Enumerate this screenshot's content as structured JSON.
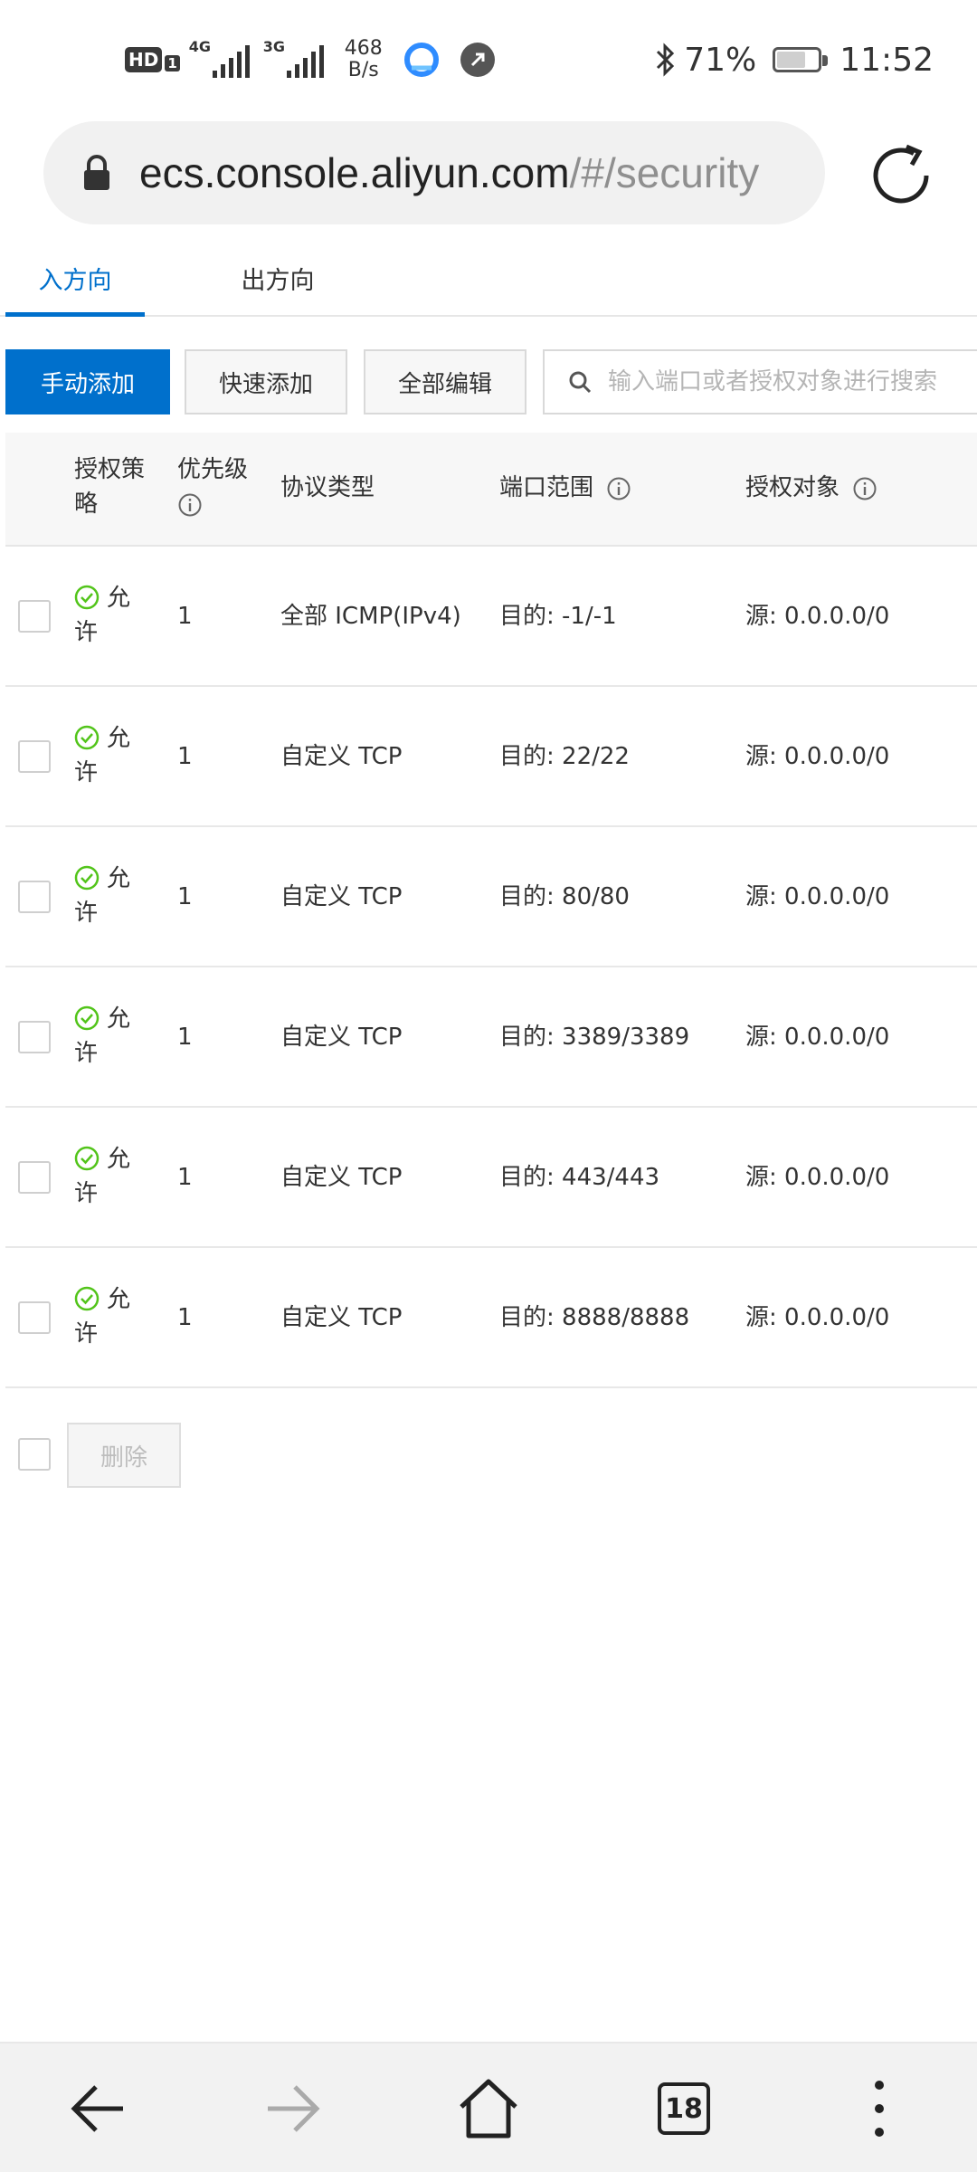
{
  "status_bar": {
    "hd": "HD",
    "sim_index": "1",
    "net1": "4G",
    "net2": "3G",
    "speed_value": "468",
    "speed_unit": "B/s",
    "battery_percent": "71%",
    "battery_level": 0.71,
    "time": "11:52"
  },
  "browser": {
    "url_host": "ecs.console.aliyun.com",
    "url_path": "/#/security",
    "tab_count": "18"
  },
  "tabs": [
    {
      "label": "入方向",
      "active": true
    },
    {
      "label": "出方向",
      "active": false
    }
  ],
  "toolbar": {
    "manual_add": "手动添加",
    "quick_add": "快速添加",
    "edit_all": "全部编辑",
    "search_placeholder": "输入端口或者授权对象进行搜索"
  },
  "table": {
    "headers": {
      "policy": "授权策略",
      "priority": "优先级",
      "protocol": "协议类型",
      "port_range": "端口范围",
      "auth_object": "授权对象"
    },
    "rows": [
      {
        "policy": "允许",
        "priority": "1",
        "protocol": "全部 ICMP(IPv4)",
        "port": "目的: -1/-1",
        "source": "源: 0.0.0.0/0"
      },
      {
        "policy": "允许",
        "priority": "1",
        "protocol": "自定义 TCP",
        "port": "目的: 22/22",
        "source": "源: 0.0.0.0/0"
      },
      {
        "policy": "允许",
        "priority": "1",
        "protocol": "自定义 TCP",
        "port": "目的: 80/80",
        "source": "源: 0.0.0.0/0"
      },
      {
        "policy": "允许",
        "priority": "1",
        "protocol": "自定义 TCP",
        "port": "目的: 3389/3389",
        "source": "源: 0.0.0.0/0"
      },
      {
        "policy": "允许",
        "priority": "1",
        "protocol": "自定义 TCP",
        "port": "目的: 443/443",
        "source": "源: 0.0.0.0/0"
      },
      {
        "policy": "允许",
        "priority": "1",
        "protocol": "自定义 TCP",
        "port": "目的: 8888/8888",
        "source": "源: 0.0.0.0/0"
      }
    ]
  },
  "footer": {
    "delete": "删除"
  },
  "colors": {
    "primary": "#0070cc",
    "allow_green": "#52c41a"
  },
  "icons": {
    "lock": "lock-icon",
    "reload": "reload-icon",
    "search": "search-icon",
    "info": "info-icon",
    "allow": "check-circle-icon",
    "back": "back-arrow-icon",
    "forward": "forward-arrow-icon",
    "home": "home-icon",
    "tabs": "tabs-icon",
    "menu": "menu-dots-icon"
  }
}
